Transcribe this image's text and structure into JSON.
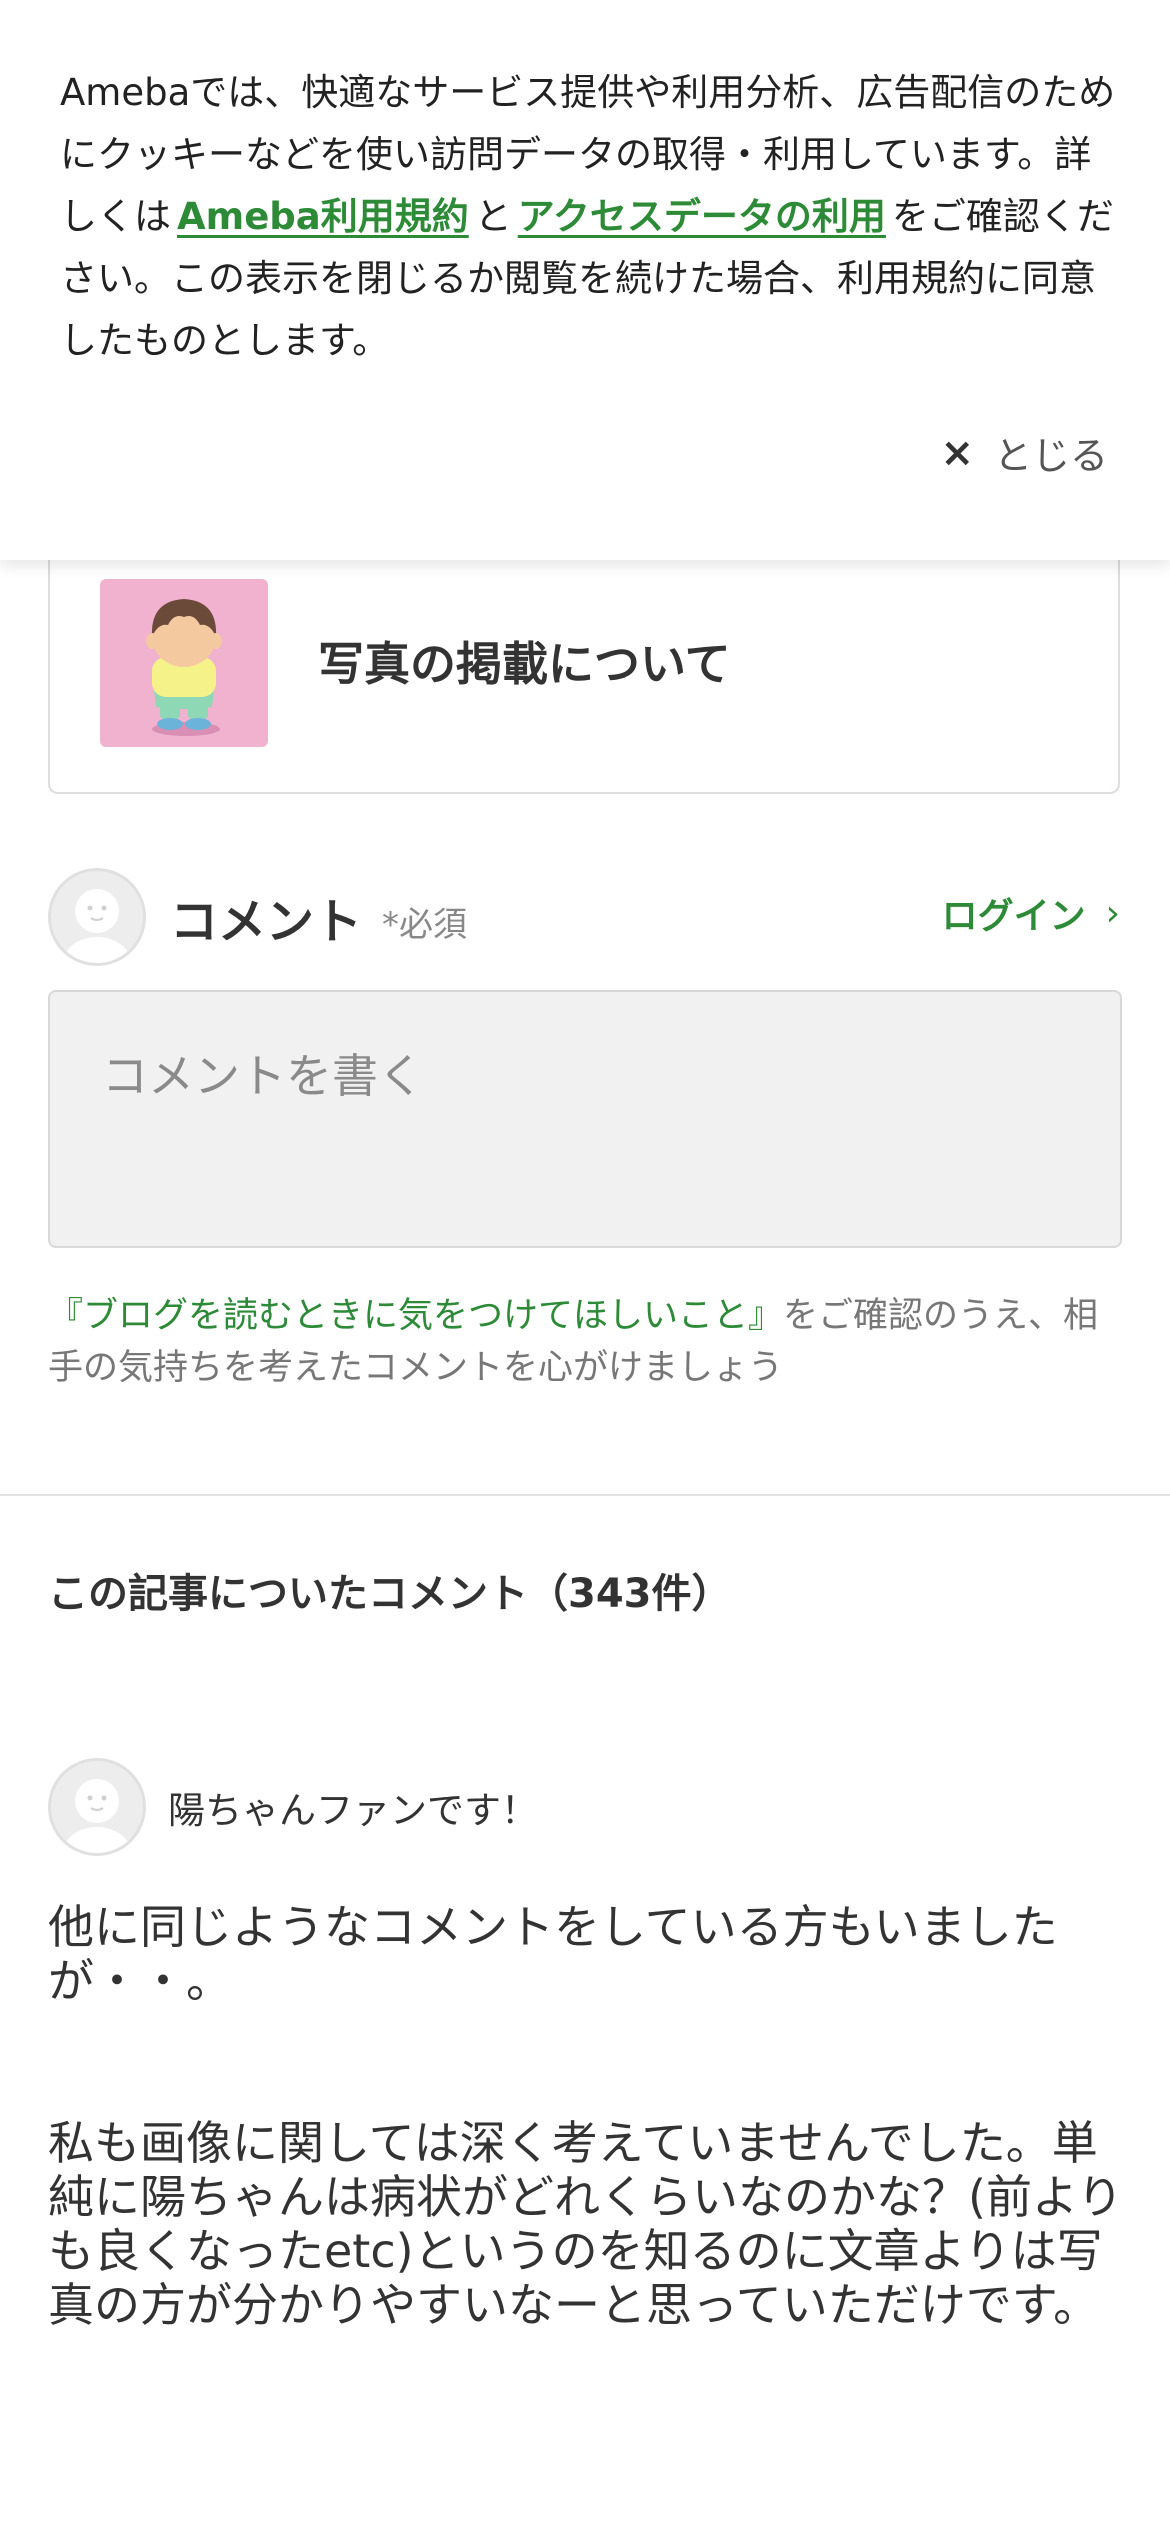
{
  "cookie_banner": {
    "text_before": "Amebaでは、快適なサービス提供や利用分析、広告配信のためにクッキーなどを使い訪問データの取得・利用しています。詳しくは",
    "link1": "Ameba利用規約",
    "text_middle": "と",
    "link2": "アクセスデータの利用",
    "text_after": "をご確認ください。この表示を閉じるか閲覧を続けた場合、利用規約に同意したものとします。",
    "close_label": "とじる",
    "close_icon": "×"
  },
  "related_article": {
    "title": "写真の掲載について"
  },
  "comment_form": {
    "heading": "コメント",
    "required_label": "*必須",
    "login_label": "ログイン",
    "login_icon": "›",
    "placeholder": "コメントを書く",
    "notice_link": "『ブログを読むときに気をつけてほしいこと』",
    "notice_text": "をご確認のうえ、相手の気持ちを考えたコメントを心がけましょう"
  },
  "comments": {
    "title": "この記事についたコメント（343件）",
    "items": [
      {
        "author": "陽ちゃんファンです！",
        "paragraph1": "他に同じようなコメントをしている方もいましたが・・。",
        "paragraph2": "私も画像に関しては深く考えていませんでした。単純に陽ちゃんは病状がどれくらいなのかな？(前よりも良くなったetc)というのを知るのに文章よりは写真の方が分かりやすいなーと思っていただけです。"
      }
    ]
  },
  "colors": {
    "accent_green": "#2d8a37",
    "thumb_pink": "#f1b2d0"
  }
}
